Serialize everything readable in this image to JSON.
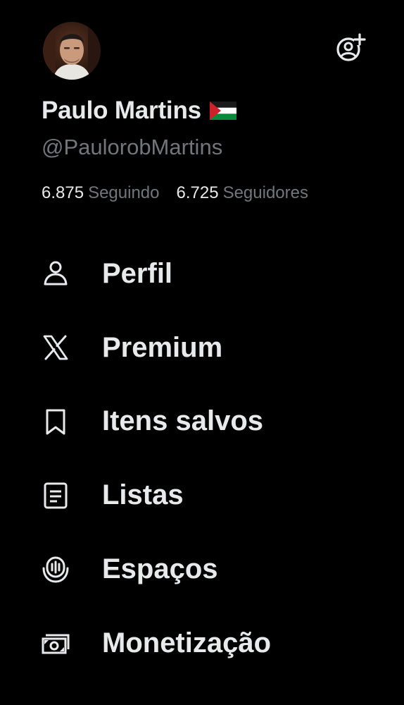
{
  "profile": {
    "display_name": "Paulo Martins",
    "flag": "🇵🇸",
    "handle": "@PaulorobMartins",
    "avatar_icon": "profile-photo",
    "add_account_icon": "add-account-icon"
  },
  "stats": {
    "following_count": "6.875",
    "following_label": "Seguindo",
    "followers_count": "6.725",
    "followers_label": "Seguidores"
  },
  "menu": {
    "items": [
      {
        "label": "Perfil",
        "icon": "person-icon"
      },
      {
        "label": "Premium",
        "icon": "x-logo-icon"
      },
      {
        "label": "Itens salvos",
        "icon": "bookmark-icon"
      },
      {
        "label": "Listas",
        "icon": "list-icon"
      },
      {
        "label": "Espaços",
        "icon": "spaces-icon"
      },
      {
        "label": "Monetização",
        "icon": "money-icon"
      }
    ]
  },
  "colors": {
    "background": "#000000",
    "primary_text": "#e7e9ea",
    "secondary_text": "#71767b"
  }
}
